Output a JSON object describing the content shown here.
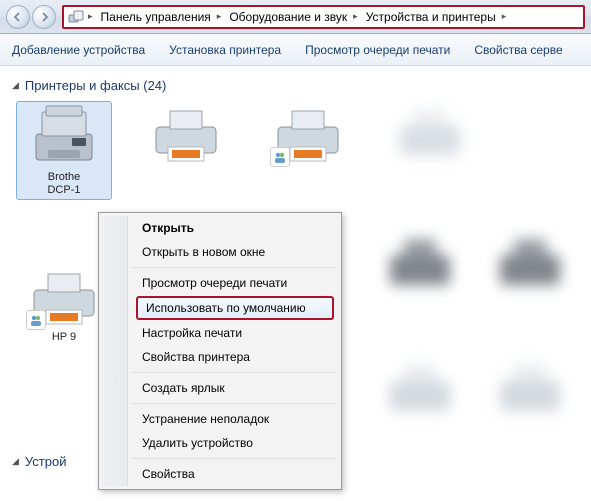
{
  "breadcrumb": {
    "root_chev": "▸",
    "items": [
      {
        "label": "Панель управления"
      },
      {
        "label": "Оборудование и звук"
      },
      {
        "label": "Устройства и принтеры"
      }
    ]
  },
  "toolbar": {
    "add_device": "Добавление устройства",
    "install_printer": "Установка принтера",
    "view_queue": "Просмотр очереди печати",
    "server_props": "Свойства серве"
  },
  "section1": {
    "title": "Принтеры и факсы (24)"
  },
  "section2": {
    "title": "Устрой"
  },
  "devices": {
    "d0": {
      "label": "Brothe\nDCP-1"
    },
    "d4": {
      "label": "HP 9"
    }
  },
  "context_menu": {
    "open": "Открыть",
    "open_new": "Открыть в новом окне",
    "view_queue": "Просмотр очереди печати",
    "set_default": "Использовать по умолчанию",
    "print_settings": "Настройка печати",
    "printer_props": "Свойства принтера",
    "create_shortcut": "Создать ярлык",
    "troubleshoot": "Устранение неполадок",
    "remove": "Удалить устройство",
    "properties": "Свойства"
  }
}
